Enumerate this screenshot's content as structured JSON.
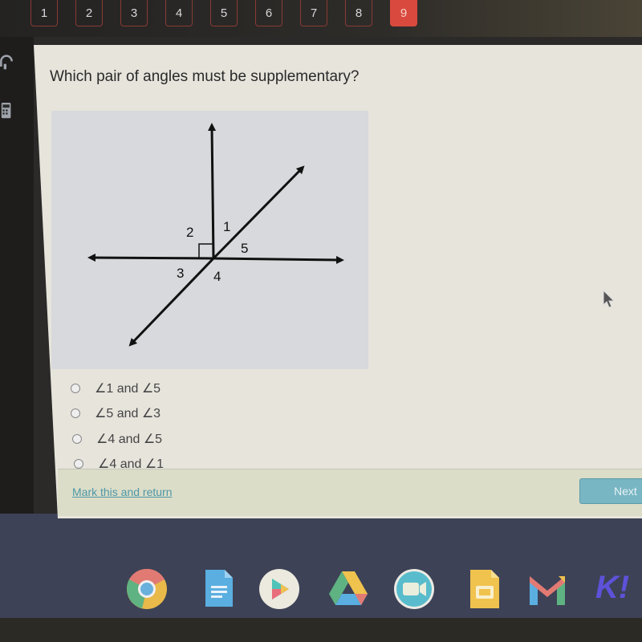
{
  "question_nav": {
    "items": [
      "1",
      "2",
      "3",
      "4",
      "5",
      "6",
      "7",
      "8",
      "9"
    ],
    "active": "9"
  },
  "question": {
    "text": "Which pair of angles must be supplementary?",
    "figure": {
      "description": "Three lines through a common point: a horizontal line, a vertical ray with a right-angle marker, and a diagonal line.",
      "angle_labels": [
        "1",
        "2",
        "3",
        "4",
        "5"
      ]
    },
    "options": [
      {
        "label": "∠1 and ∠5",
        "selected": false
      },
      {
        "label": "∠5 and ∠3",
        "selected": false
      },
      {
        "label": "∠4 and ∠5",
        "selected": false
      },
      {
        "label": "∠4 and ∠1",
        "selected": false
      }
    ]
  },
  "footer": {
    "mark_link": "Mark this and return",
    "next_button": "Next"
  },
  "sidebar": {
    "icons": [
      "headphones-icon",
      "calculator-icon"
    ]
  },
  "dock": {
    "apps": [
      "Chrome",
      "Google Docs",
      "Play Store",
      "Google Drive",
      "Zoom",
      "Google Slides",
      "Gmail",
      "Kahoot!"
    ],
    "kahoot_text": "K!"
  },
  "colors": {
    "active_question": "#d9493e",
    "link": "#4e98a8",
    "next_button": "#79b6c4"
  }
}
